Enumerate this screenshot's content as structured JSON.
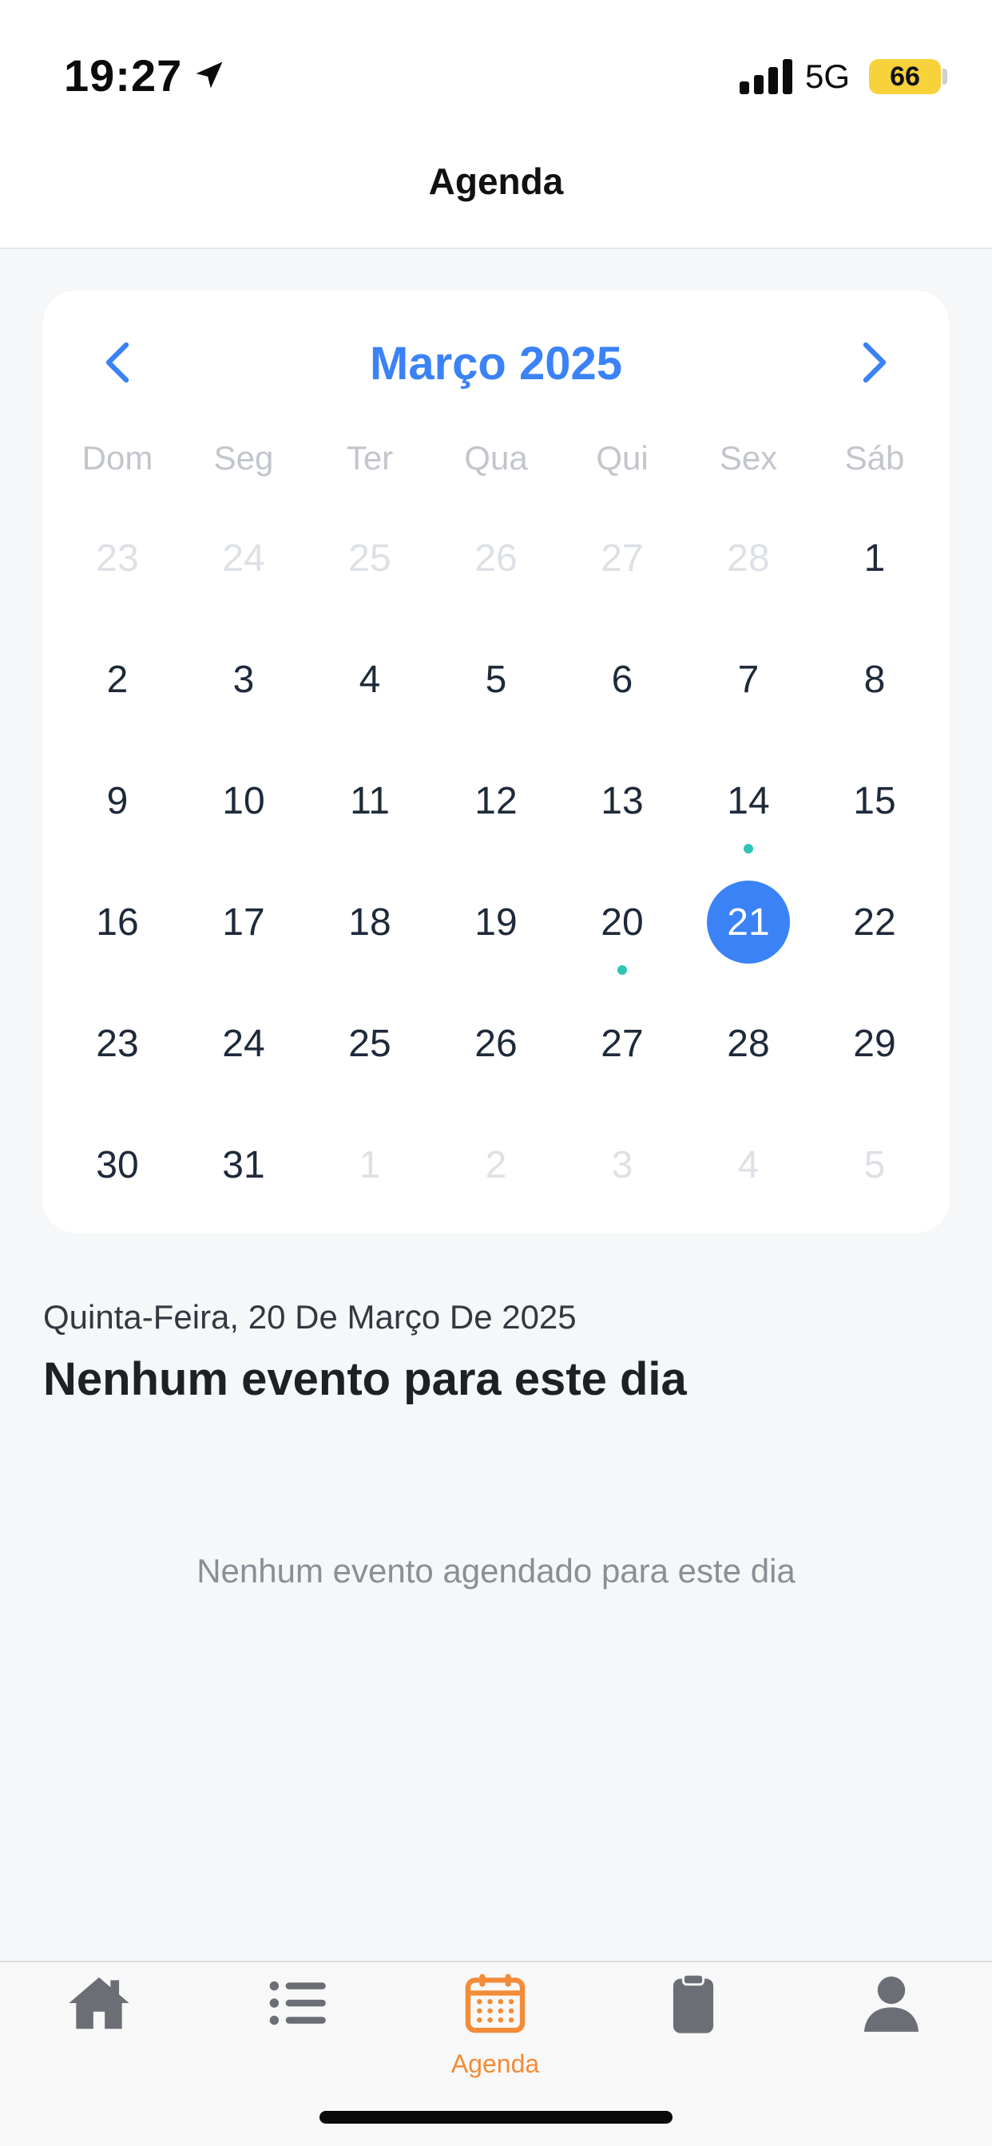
{
  "status_bar": {
    "time": "19:27",
    "network": "5G",
    "battery": "66",
    "battery_color": "#f7d23a"
  },
  "nav": {
    "title": "Agenda"
  },
  "calendar": {
    "month_label": "Março 2025",
    "accent_color": "#3b82f6",
    "event_dot_color": "#2ec4b6",
    "weekdays": [
      "Dom",
      "Seg",
      "Ter",
      "Qua",
      "Qui",
      "Sex",
      "Sáb"
    ],
    "weeks": [
      [
        {
          "d": "23",
          "muted": true
        },
        {
          "d": "24",
          "muted": true
        },
        {
          "d": "25",
          "muted": true
        },
        {
          "d": "26",
          "muted": true
        },
        {
          "d": "27",
          "muted": true
        },
        {
          "d": "28",
          "muted": true
        },
        {
          "d": "1"
        }
      ],
      [
        {
          "d": "2"
        },
        {
          "d": "3"
        },
        {
          "d": "4"
        },
        {
          "d": "5"
        },
        {
          "d": "6"
        },
        {
          "d": "7"
        },
        {
          "d": "8"
        }
      ],
      [
        {
          "d": "9"
        },
        {
          "d": "10"
        },
        {
          "d": "11"
        },
        {
          "d": "12"
        },
        {
          "d": "13"
        },
        {
          "d": "14",
          "event": true
        },
        {
          "d": "15"
        }
      ],
      [
        {
          "d": "16"
        },
        {
          "d": "17"
        },
        {
          "d": "18"
        },
        {
          "d": "19"
        },
        {
          "d": "20",
          "event": true
        },
        {
          "d": "21",
          "selected": true
        },
        {
          "d": "22"
        }
      ],
      [
        {
          "d": "23"
        },
        {
          "d": "24"
        },
        {
          "d": "25"
        },
        {
          "d": "26"
        },
        {
          "d": "27"
        },
        {
          "d": "28"
        },
        {
          "d": "29"
        }
      ],
      [
        {
          "d": "30"
        },
        {
          "d": "31"
        },
        {
          "d": "1",
          "muted": true
        },
        {
          "d": "2",
          "muted": true
        },
        {
          "d": "3",
          "muted": true
        },
        {
          "d": "4",
          "muted": true
        },
        {
          "d": "5",
          "muted": true
        }
      ]
    ]
  },
  "day_section": {
    "date_label": "Quinta-Feira, 20 De Março De 2025",
    "heading": "Nenhum evento para este dia",
    "empty_message": "Nenhum evento agendado para este dia"
  },
  "tab_bar": {
    "active_color": "#f28c38",
    "inactive_color": "#6b6f75",
    "tabs": [
      {
        "icon": "home-icon",
        "label": ""
      },
      {
        "icon": "list-icon",
        "label": ""
      },
      {
        "icon": "calendar-icon",
        "label": "Agenda",
        "active": true
      },
      {
        "icon": "clipboard-icon",
        "label": ""
      },
      {
        "icon": "user-icon",
        "label": ""
      }
    ]
  }
}
